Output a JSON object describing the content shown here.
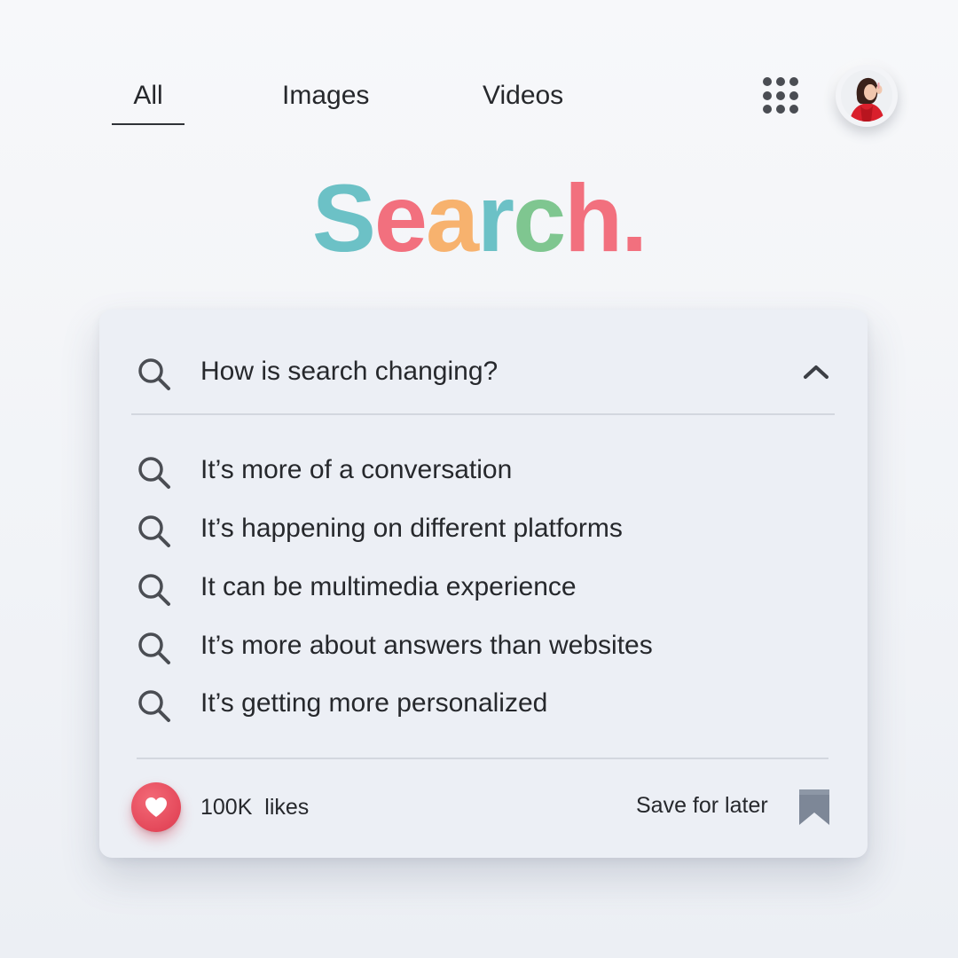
{
  "nav": {
    "tabs": [
      {
        "label": "All",
        "active": true
      },
      {
        "label": "Images",
        "active": false
      },
      {
        "label": "Videos",
        "active": false
      }
    ],
    "apps_icon": "grid-apps-icon",
    "avatar": "user-avatar"
  },
  "logo": {
    "letters": [
      {
        "char": "S",
        "color": "#6cc1c6"
      },
      {
        "char": "e",
        "color": "#f2707e"
      },
      {
        "char": "a",
        "color": "#f7b26e"
      },
      {
        "char": "r",
        "color": "#6cc1c6"
      },
      {
        "char": "c",
        "color": "#7fc690"
      },
      {
        "char": "h",
        "color": "#f2707e"
      },
      {
        "char": ".",
        "color": "#f2707e"
      }
    ]
  },
  "search": {
    "query": "How is search changing?",
    "collapse_icon": "chevron-up-icon",
    "suggestions": [
      "It’s more of a conversation",
      "It’s happening on different platforms",
      "It can be multimedia experience",
      "It’s more about answers than websites",
      "It’s getting more personalized"
    ]
  },
  "footer": {
    "likes_count": "100K",
    "likes_label": "100K  likes",
    "like_icon": "heart-icon",
    "save_label": "Save for later",
    "save_icon": "bookmark-icon"
  },
  "colors": {
    "background": "#f3f5f8",
    "card": "#eceff5",
    "heart": "#e4485a",
    "bookmark": "#7d8797",
    "icon": "#4a4d53"
  }
}
